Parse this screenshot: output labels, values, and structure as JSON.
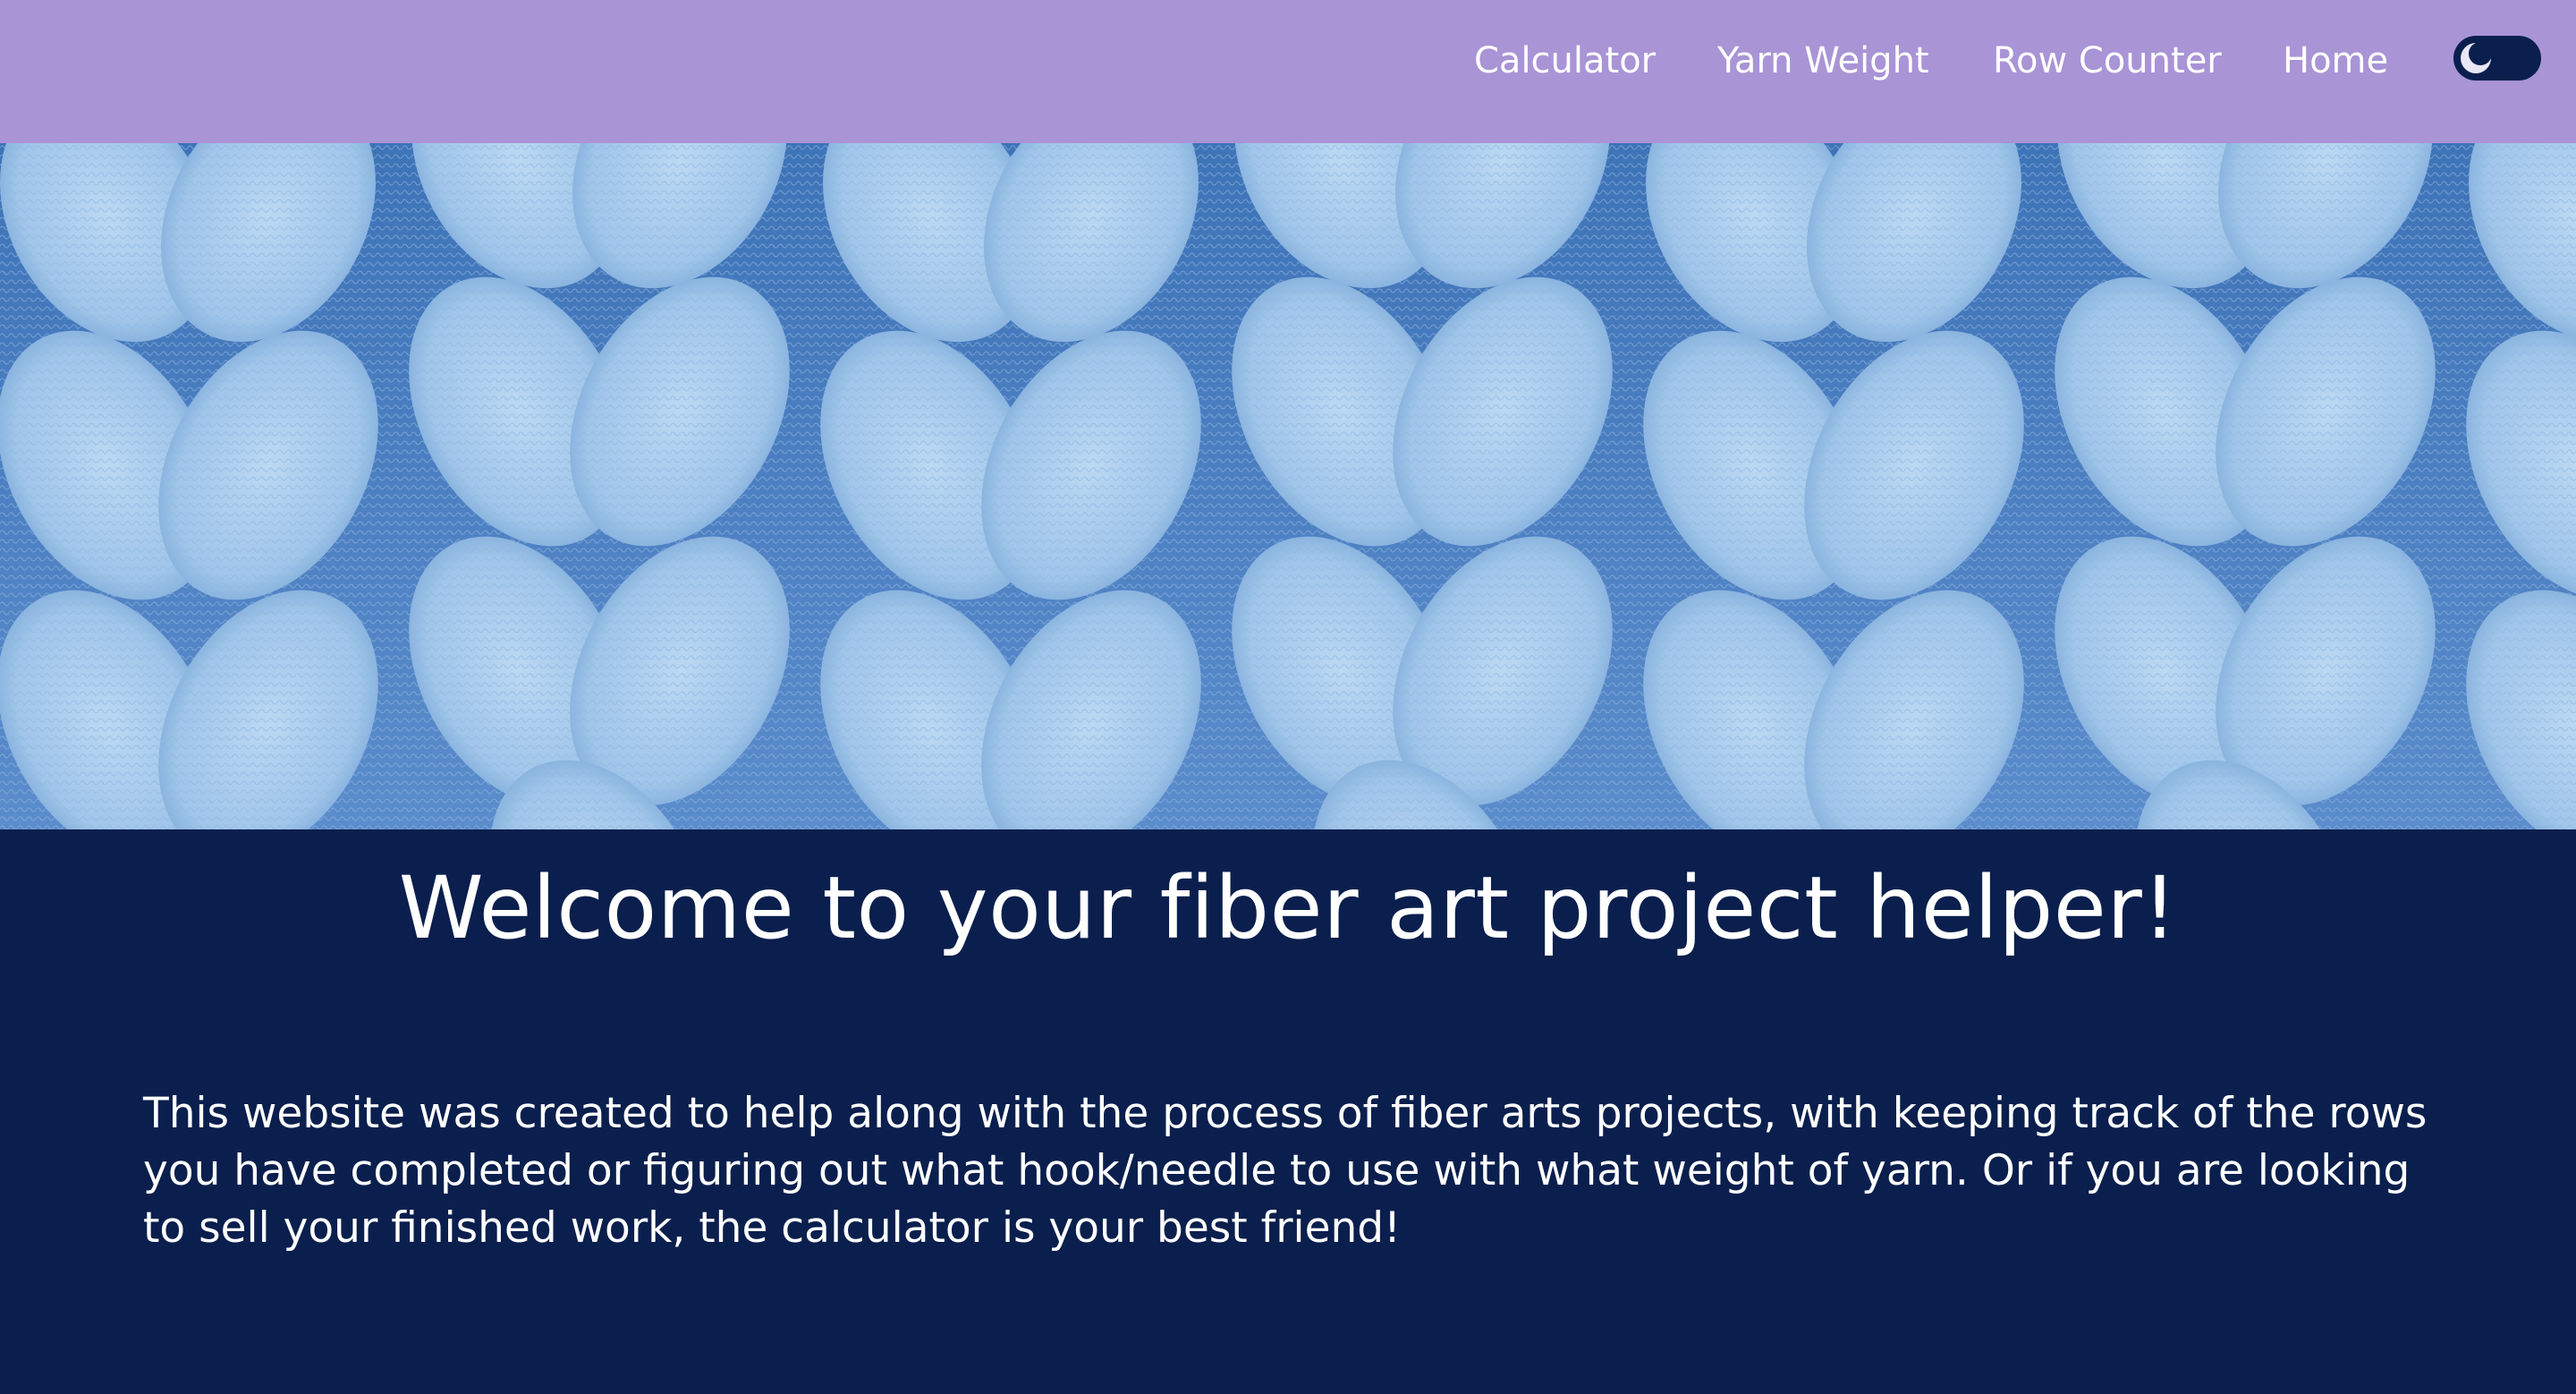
{
  "nav": {
    "links": [
      {
        "label": "Calculator"
      },
      {
        "label": "Yarn Weight"
      },
      {
        "label": "Row Counter"
      },
      {
        "label": "Home"
      }
    ],
    "theme_toggle_icon": "moon-icon"
  },
  "hero": {
    "image": "blue-chunky-knit-braids"
  },
  "main": {
    "title": "Welcome to your fiber art project helper!",
    "intro": "This website was created to help along with the process of fiber arts projects, with keeping track of the rows you have completed or figuring out what hook/needle to use with what weight of yarn. Or if you are looking to sell your finished work, the calculator is your best friend!"
  },
  "colors": {
    "navbar": "#a994d6",
    "background": "#0a1f4d",
    "text": "#ffffff",
    "yarn": "#9fc6ea"
  }
}
